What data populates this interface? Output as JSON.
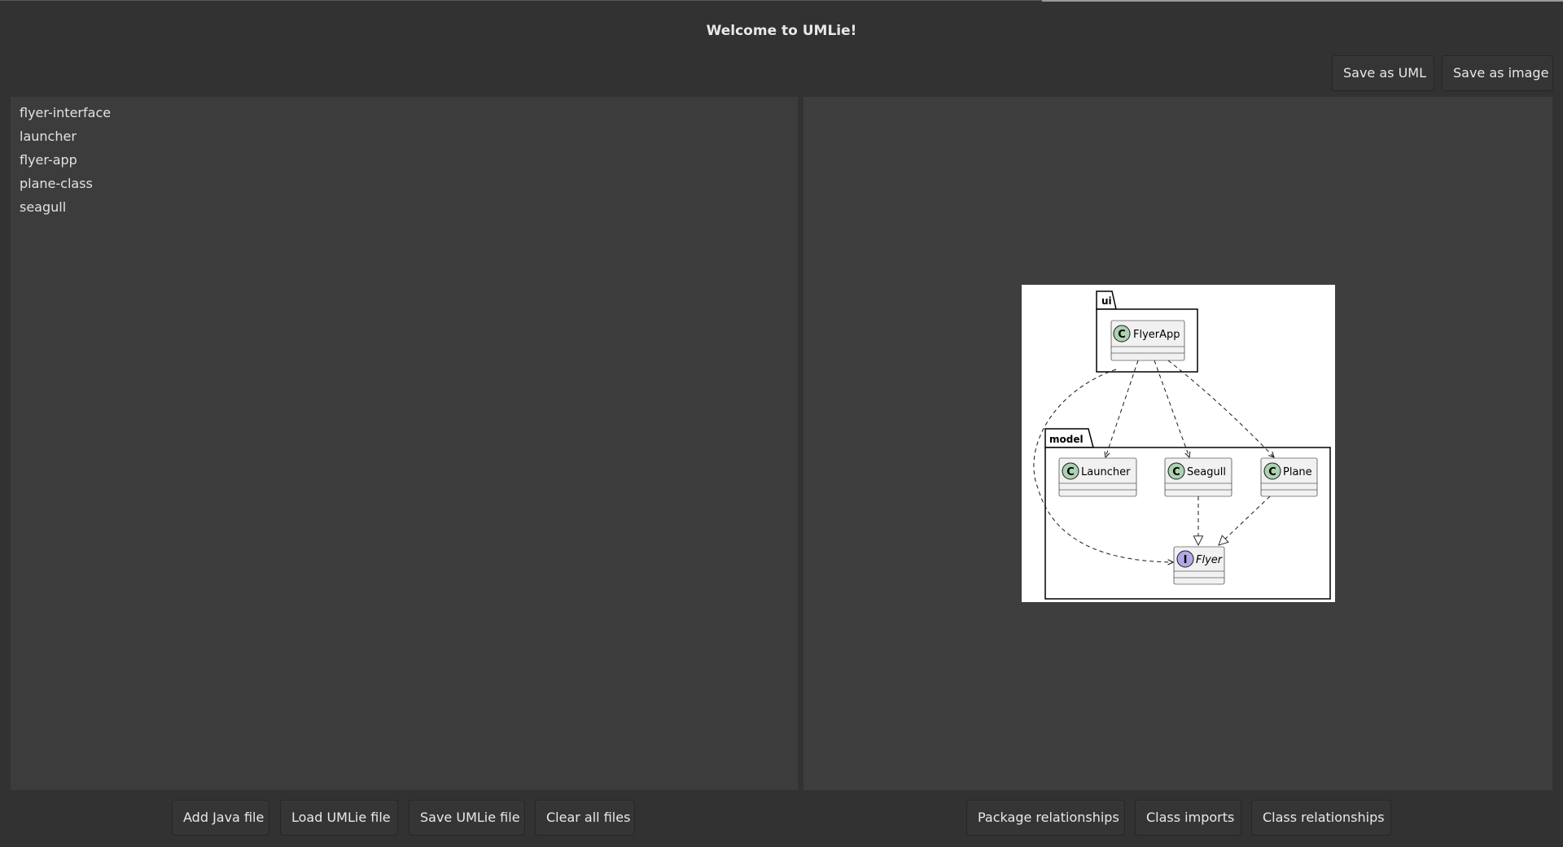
{
  "window": {
    "title": "Welcome to UMLie!"
  },
  "toolbar": {
    "save_as_uml": "Save as UML",
    "save_as_image": "Save as image"
  },
  "files": [
    {
      "label": "flyer-interface"
    },
    {
      "label": "launcher"
    },
    {
      "label": "flyer-app"
    },
    {
      "label": "plane-class"
    },
    {
      "label": "seagull"
    }
  ],
  "diagram": {
    "packages": {
      "ui": "ui",
      "model": "model"
    },
    "classes": {
      "flyerapp": "FlyerApp",
      "launcher": "Launcher",
      "seagull": "Seagull",
      "plane": "Plane"
    },
    "interfaces": {
      "flyer": "Flyer"
    },
    "stereotype_glyphs": {
      "class": "C",
      "interface": "I"
    },
    "colors": {
      "class_circle": "#add1b2",
      "interface_circle": "#b4a7e5",
      "box_fill": "#f1f1f1"
    }
  },
  "bottom_left": {
    "add_java_file": "Add Java file",
    "load_umlie_file": "Load UMLie file",
    "save_umlie_file": "Save UMLie file",
    "clear_all_files": "Clear all files"
  },
  "bottom_right": {
    "package_relationships": "Package relationships",
    "class_imports": "Class imports",
    "class_relationships": "Class relationships"
  }
}
